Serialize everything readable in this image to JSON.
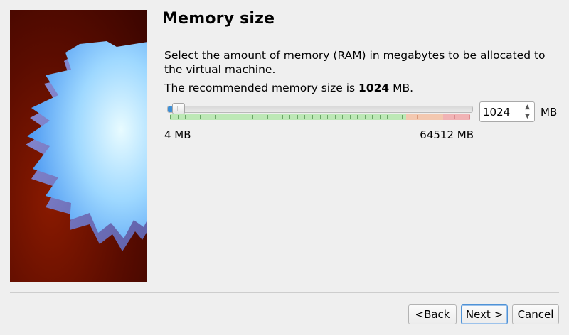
{
  "wizard": {
    "title": "Memory size",
    "description": "Select the amount of memory (RAM) in megabytes to be allocated to the virtual machine.",
    "recommend_prefix": "The recommended memory size is ",
    "recommend_value": "1024",
    "recommend_suffix": " MB."
  },
  "memory": {
    "min_label": "4 MB",
    "max_label": "64512 MB",
    "value": "1024",
    "unit": "MB",
    "slider_fraction": 0.016
  },
  "buttons": {
    "back_prefix": "< ",
    "back_mnemonic": "B",
    "back_rest": "ack",
    "next_mnemonic": "N",
    "next_rest": "ext >",
    "cancel": "Cancel"
  },
  "colors": {
    "accent": "#3d8fd6",
    "safe_zone": "#bde8b6",
    "warn_zone": "#f3c8b0",
    "danger_zone": "#f1b3b5"
  },
  "icons": {
    "art": "virtualbox-star-art",
    "spin_up": "spin-up-icon",
    "spin_down": "spin-down-icon"
  }
}
